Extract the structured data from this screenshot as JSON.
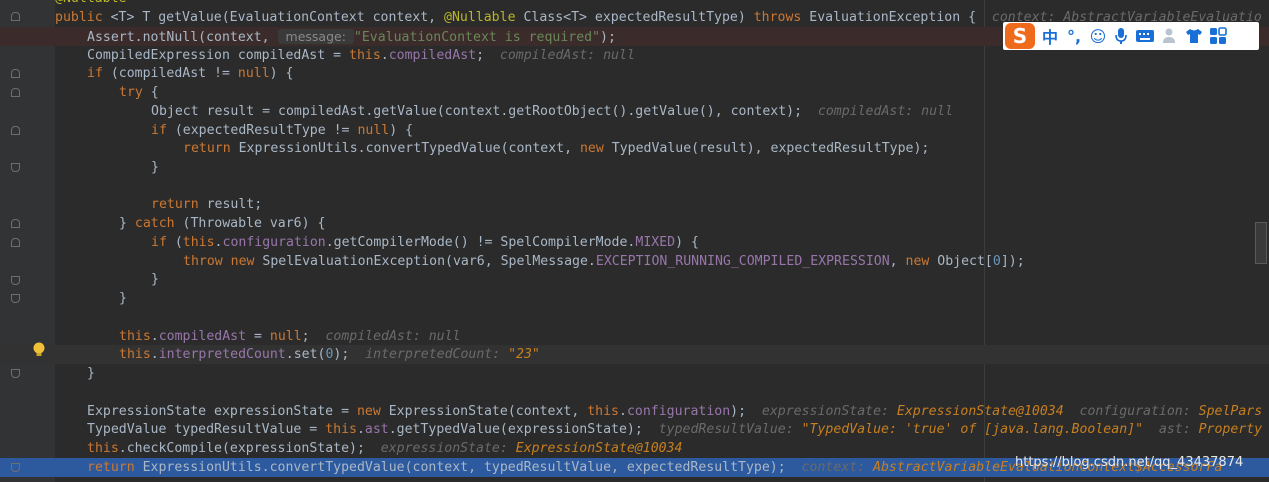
{
  "editor": {
    "lines": [
      {
        "seg": [
          {
            "t": "@Nullable",
            "c": "ann"
          }
        ]
      },
      {
        "seg": [
          {
            "t": "public ",
            "c": "kw"
          },
          {
            "t": "<T> T getValue(EvaluationContext context, "
          },
          {
            "t": "@Nullable",
            "c": "ann"
          },
          {
            "t": " Class<T> expectedResultType) "
          },
          {
            "t": "throws",
            "c": "kw"
          },
          {
            "t": " EvaluationException {  "
          },
          {
            "t": "context: AbstractVariableEvaluatio",
            "c": "hint"
          }
        ]
      },
      {
        "seg": [
          {
            "t": "Assert.notNull(context, "
          },
          {
            "t": " message: ",
            "c": "param-hint"
          },
          {
            "t": "\"EvaluationContext is required\"",
            "c": "str"
          },
          {
            "t": ");"
          }
        ]
      },
      {
        "seg": [
          {
            "t": "CompiledExpression compiledAst = "
          },
          {
            "t": "this",
            "c": "kw"
          },
          {
            "t": "."
          },
          {
            "t": "compiledAst",
            "c": "fld"
          },
          {
            "t": ";  "
          },
          {
            "t": "compiledAst: null",
            "c": "hint"
          }
        ]
      },
      {
        "seg": [
          {
            "t": "if",
            "c": "kw"
          },
          {
            "t": " (compiledAst != "
          },
          {
            "t": "null",
            "c": "kw"
          },
          {
            "t": ") {"
          }
        ]
      },
      {
        "seg": [
          {
            "t": "try",
            "c": "kw"
          },
          {
            "t": " {"
          }
        ]
      },
      {
        "seg": [
          {
            "t": "Object result = compiledAst.getValue(context.getRootObject().getValue(), context);  "
          },
          {
            "t": "compiledAst: null",
            "c": "hint"
          }
        ]
      },
      {
        "seg": [
          {
            "t": "if",
            "c": "kw"
          },
          {
            "t": " (expectedResultType != "
          },
          {
            "t": "null",
            "c": "kw"
          },
          {
            "t": ") {"
          }
        ]
      },
      {
        "seg": [
          {
            "t": "return",
            "c": "kw"
          },
          {
            "t": " ExpressionUtils.convertTypedValue(context, "
          },
          {
            "t": "new",
            "c": "kw"
          },
          {
            "t": " TypedValue(result), expectedResultType);"
          }
        ]
      },
      {
        "seg": [
          {
            "t": "}"
          }
        ]
      },
      {
        "seg": []
      },
      {
        "seg": [
          {
            "t": "return",
            "c": "kw"
          },
          {
            "t": " result;"
          }
        ]
      },
      {
        "seg": [
          {
            "t": "} "
          },
          {
            "t": "catch",
            "c": "kw"
          },
          {
            "t": " (Throwable var6) {"
          }
        ]
      },
      {
        "seg": [
          {
            "t": "if",
            "c": "kw"
          },
          {
            "t": " ("
          },
          {
            "t": "this",
            "c": "kw"
          },
          {
            "t": "."
          },
          {
            "t": "configuration",
            "c": "fld"
          },
          {
            "t": ".getCompilerMode() != SpelCompilerMode."
          },
          {
            "t": "MIXED",
            "c": "fld"
          },
          {
            "t": ") {"
          }
        ]
      },
      {
        "seg": [
          {
            "t": "throw new",
            "c": "kw"
          },
          {
            "t": " SpelEvaluationException(var6, SpelMessage."
          },
          {
            "t": "EXCEPTION_RUNNING_COMPILED_EXPRESSION",
            "c": "fld"
          },
          {
            "t": ", "
          },
          {
            "t": "new",
            "c": "kw"
          },
          {
            "t": " Object["
          },
          {
            "t": "0",
            "c": "num"
          },
          {
            "t": "]);"
          }
        ]
      },
      {
        "seg": [
          {
            "t": "}"
          }
        ]
      },
      {
        "seg": [
          {
            "t": "}"
          }
        ]
      },
      {
        "seg": []
      },
      {
        "seg": [
          {
            "t": "this",
            "c": "kw"
          },
          {
            "t": "."
          },
          {
            "t": "compiledAst",
            "c": "fld"
          },
          {
            "t": " = "
          },
          {
            "t": "null",
            "c": "kw"
          },
          {
            "t": ";  "
          },
          {
            "t": "compiledAst: null",
            "c": "hint"
          }
        ]
      },
      {
        "seg": [
          {
            "t": "this",
            "c": "kw"
          },
          {
            "t": "."
          },
          {
            "t": "interpretedCount",
            "c": "fld"
          },
          {
            "t": ".set("
          },
          {
            "t": "0",
            "c": "num"
          },
          {
            "t": ");  "
          },
          {
            "t": "interpretedCount: ",
            "c": "hint"
          },
          {
            "t": "\"23\"",
            "c": "hintv"
          }
        ]
      },
      {
        "seg": [
          {
            "t": "}"
          }
        ]
      },
      {
        "seg": []
      },
      {
        "seg": [
          {
            "t": "ExpressionState expressionState = "
          },
          {
            "t": "new",
            "c": "kw"
          },
          {
            "t": " ExpressionState(context, "
          },
          {
            "t": "this",
            "c": "kw"
          },
          {
            "t": "."
          },
          {
            "t": "configuration",
            "c": "fld"
          },
          {
            "t": ");  "
          },
          {
            "t": "expressionState: ",
            "c": "hint"
          },
          {
            "t": "ExpressionState@10034",
            "c": "hintv"
          },
          {
            "t": "  configuration: ",
            "c": "hint"
          },
          {
            "t": "SpelPars",
            "c": "hintv"
          }
        ]
      },
      {
        "seg": [
          {
            "t": "TypedValue typedResultValue = "
          },
          {
            "t": "this",
            "c": "kw"
          },
          {
            "t": "."
          },
          {
            "t": "ast",
            "c": "fld"
          },
          {
            "t": ".getTypedValue(expressionState);  "
          },
          {
            "t": "typedResultValue: ",
            "c": "hint"
          },
          {
            "t": "\"TypedValue: 'true' of [java.lang.Boolean]\"",
            "c": "hintv"
          },
          {
            "t": "  ast: ",
            "c": "hint"
          },
          {
            "t": "Property",
            "c": "hintv"
          }
        ]
      },
      {
        "seg": [
          {
            "t": "this",
            "c": "kw"
          },
          {
            "t": ".checkCompile(expressionState);  "
          },
          {
            "t": "expressionState: ",
            "c": "hint"
          },
          {
            "t": "ExpressionState@10034",
            "c": "hintv"
          }
        ]
      },
      {
        "seg": [
          {
            "t": "return",
            "c": "kw"
          },
          {
            "t": " ExpressionUtils.convertTypedValue(context, typedResultValue, expectedResultType);  "
          },
          {
            "t": "context: ",
            "c": "hint"
          },
          {
            "t": "AbstractVariableEvaluationContext$AccessorFa",
            "c": "hintv"
          }
        ]
      }
    ]
  },
  "ime_toolbar": {
    "logo": "S",
    "mode": "中",
    "punct": "°,",
    "icons": [
      "emoji-icon",
      "microphone-icon",
      "keyboard-icon",
      "user-icon",
      "shirt-icon",
      "grid-icon"
    ]
  },
  "watermark": "https://blog.csdn.net/qq_43437874"
}
